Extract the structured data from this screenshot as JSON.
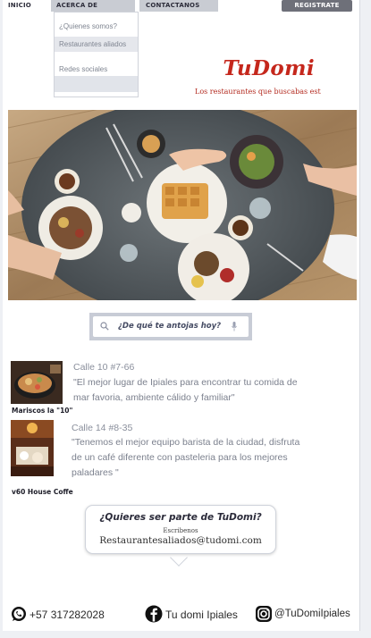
{
  "nav": {
    "home": "INICIO",
    "about": "ACERCA DE NOSOTROS",
    "contact": "CONTACTANOS",
    "register": "REGISTRATE"
  },
  "dropdown": {
    "items": [
      "¿Quienes somos?",
      "Restaurantes aliados",
      "Redes sociales",
      ""
    ]
  },
  "brand": {
    "name": "TuDomi",
    "tagline": "Los restaurantes que buscabas est",
    "color": "#c5271c"
  },
  "hero": {
    "icon": "food-table-photo"
  },
  "search": {
    "placeholder": "¿De qué te antojas hoy?"
  },
  "restaurants": [
    {
      "name": "Mariscos la \"10\"",
      "address": "Calle 10 #7-66",
      "description": "\"El mejor lugar de Ipiales para encontrar tu comida de mar favoria, ambiente cálido y familiar\""
    },
    {
      "name": "v60 House Coffe",
      "address": "Calle 14 #8-35",
      "description": "\"Tenemos el mejor equipo barista de la ciudad, disfruta de un café diferente con pasteleria para los mejores paladares \""
    }
  ],
  "cta": {
    "title": "¿Quieres ser parte de TuDomi?",
    "subtitle": "Escribenos",
    "email": "Restaurantesaliados@tudomi.com"
  },
  "footer": {
    "phone": "+57 317282028",
    "facebook": "Tu domi Ipiales",
    "instagram": "@TuDomiIpiales"
  }
}
